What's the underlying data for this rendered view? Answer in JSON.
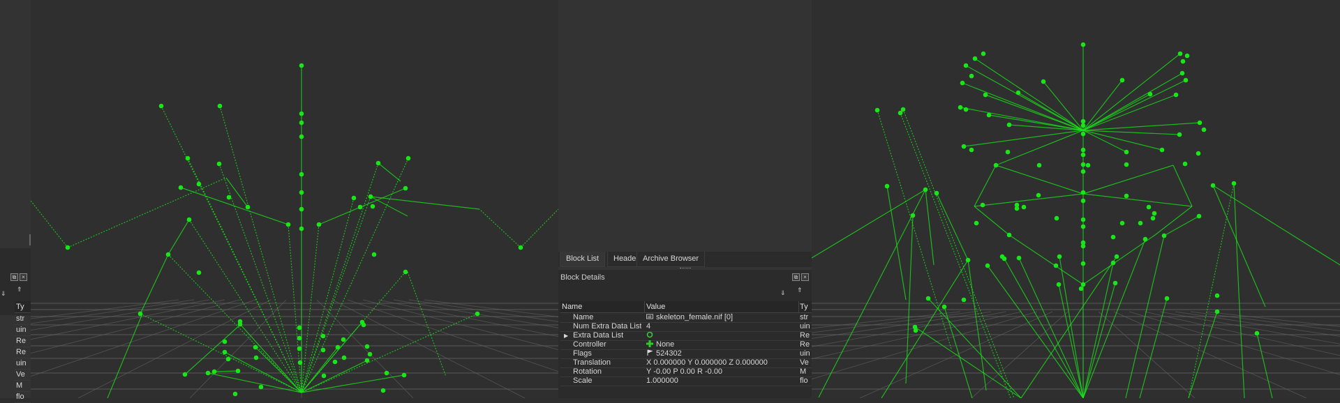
{
  "left_table": {
    "col_header": "Ty",
    "rows": [
      "str",
      "uin",
      "Re",
      "Re",
      "uin",
      "Ve",
      "M",
      "flo"
    ]
  },
  "middle": {
    "tabs": [
      {
        "label": "Block List",
        "active": true
      },
      {
        "label": "Header",
        "active": false
      },
      {
        "label": "Archive Browser",
        "active": false
      }
    ],
    "dock_title": "Block Details",
    "columns": {
      "name": "Name",
      "value": "Value",
      "type": "Ty"
    },
    "rows": [
      {
        "name": "Name",
        "value": "skeleton_female.nif [0]",
        "icon": "string-icon",
        "type": "str",
        "expand": false
      },
      {
        "name": "Num Extra Data List",
        "value": "4",
        "icon": "",
        "type": "uin",
        "expand": false
      },
      {
        "name": "Extra Data List",
        "value": "",
        "icon": "refresh-icon",
        "type": "Re",
        "expand": true
      },
      {
        "name": "Controller",
        "value": "None",
        "icon": "add-link-icon",
        "type": "Re",
        "expand": false
      },
      {
        "name": "Flags",
        "value": "524302",
        "icon": "flags-icon",
        "type": "uin",
        "expand": false
      },
      {
        "name": "Translation",
        "value": "X 0.000000 Y 0.000000 Z 0.000000",
        "icon": "",
        "type": "Ve",
        "expand": false
      },
      {
        "name": "Rotation",
        "value": "Y -0.00 P 0.00 R -0.00",
        "icon": "",
        "type": "M",
        "expand": false
      },
      {
        "name": "Scale",
        "value": "1.000000",
        "icon": "",
        "type": "flo",
        "expand": false
      }
    ]
  },
  "colors": {
    "bone": "#19e619",
    "grid": "#6a6a6a",
    "background": "#2f2f2f"
  }
}
